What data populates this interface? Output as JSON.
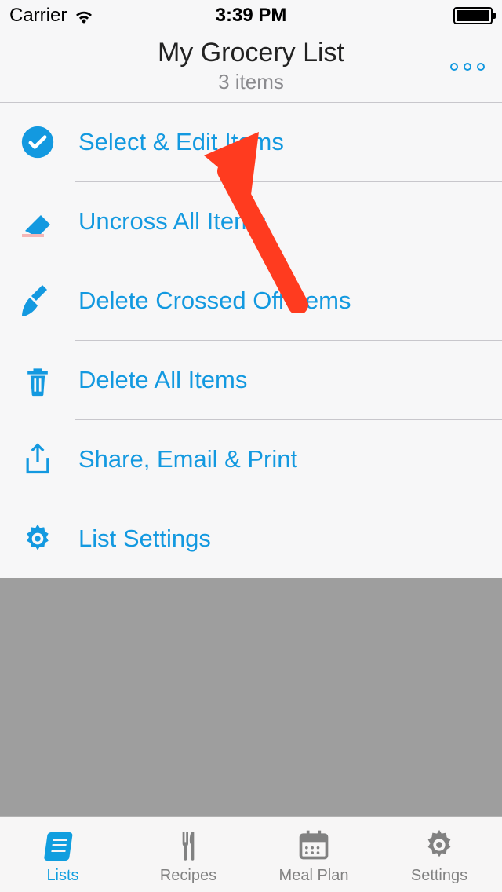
{
  "status_bar": {
    "carrier": "Carrier",
    "time": "3:39 PM"
  },
  "header": {
    "title": "My Grocery List",
    "subtitle": "3 items"
  },
  "menu": [
    {
      "label": "Select & Edit Items",
      "icon": "check-circle"
    },
    {
      "label": "Uncross All Items",
      "icon": "eraser"
    },
    {
      "label": "Delete Crossed Off Items",
      "icon": "broom"
    },
    {
      "label": "Delete All Items",
      "icon": "trash"
    },
    {
      "label": "Share, Email & Print",
      "icon": "share"
    },
    {
      "label": "List Settings",
      "icon": "gear"
    }
  ],
  "tabs": [
    {
      "label": "Lists",
      "active": true
    },
    {
      "label": "Recipes",
      "active": false
    },
    {
      "label": "Meal Plan",
      "active": false
    },
    {
      "label": "Settings",
      "active": false
    }
  ],
  "accent_color": "#1399e0"
}
